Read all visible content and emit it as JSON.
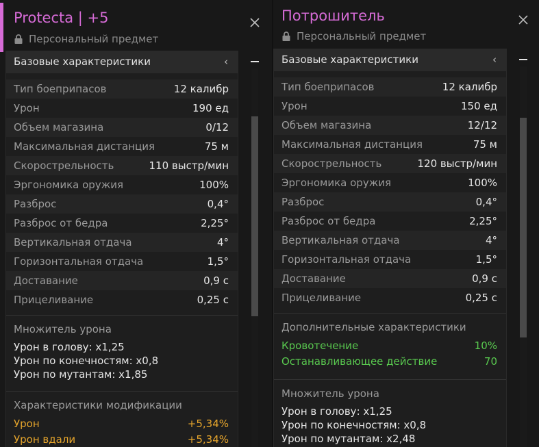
{
  "left": {
    "title": "Protecta | +5",
    "subtitle": "Персональный предмет",
    "section_title": "Базовые характеристики",
    "stats": [
      {
        "k": "Тип боеприпасов",
        "v": "12 калибр"
      },
      {
        "k": "Урон",
        "v": "190 ед"
      },
      {
        "k": "Объем магазина",
        "v": "0/12"
      },
      {
        "k": "Максимальная дистанция",
        "v": "75 м"
      },
      {
        "k": "Скорострельность",
        "v": "110 выстр/мин"
      },
      {
        "k": "Эргономика оружия",
        "v": "100%"
      },
      {
        "k": "Разброс",
        "v": "0,4°"
      },
      {
        "k": "Разброс от бедра",
        "v": "2,25°"
      },
      {
        "k": "Вертикальная отдача",
        "v": "4°"
      },
      {
        "k": "Горизонтальная отдача",
        "v": "1,5°"
      },
      {
        "k": "Доставание",
        "v": "0,9 с"
      },
      {
        "k": "Прицеливание",
        "v": "0,25 с"
      }
    ],
    "damage_multiplier": {
      "title": "Множитель урона",
      "lines": [
        "Урон в голову: x1,25",
        "Урон по конечностям: x0,8",
        "Урон по мутантам: x1,85"
      ]
    },
    "mod_stats": {
      "title": "Характеристики модификации",
      "items": [
        {
          "k": "Урон",
          "v": "+5,34%"
        },
        {
          "k": "Урон вдали",
          "v": "+5,34%"
        }
      ]
    }
  },
  "right": {
    "title": "Потрошитель",
    "subtitle": "Персональный предмет",
    "section_title": "Базовые характеристики",
    "stats": [
      {
        "k": "Тип боеприпасов",
        "v": "12 калибр"
      },
      {
        "k": "Урон",
        "v": "150 ед"
      },
      {
        "k": "Объем магазина",
        "v": "12/12"
      },
      {
        "k": "Максимальная дистанция",
        "v": "75 м"
      },
      {
        "k": "Скорострельность",
        "v": "120 выстр/мин"
      },
      {
        "k": "Эргономика оружия",
        "v": "100%"
      },
      {
        "k": "Разброс",
        "v": "0,4°"
      },
      {
        "k": "Разброс от бедра",
        "v": "2,25°"
      },
      {
        "k": "Вертикальная отдача",
        "v": "4°"
      },
      {
        "k": "Горизонтальная отдача",
        "v": "1,5°"
      },
      {
        "k": "Доставание",
        "v": "0,9 с"
      },
      {
        "k": "Прицеливание",
        "v": "0,25 с"
      }
    ],
    "extra_stats": {
      "title": "Дополнительные характеристики",
      "items": [
        {
          "k": "Кровотечение",
          "v": "10%"
        },
        {
          "k": "Останавливающее действие",
          "v": "70"
        }
      ]
    },
    "damage_multiplier": {
      "title": "Множитель урона",
      "lines": [
        "Урон в голову: x1,25",
        "Урон по конечностям: x0,8",
        "Урон по мутантам: x2,48"
      ]
    }
  },
  "icons": {
    "lock": "lock-icon",
    "close": "close-icon",
    "chevron": "chevron-left-icon",
    "collapse": "minus-icon"
  },
  "colors": {
    "title": "#d66bd6",
    "mod_value": "#e6a52c",
    "extra_value": "#59c94f"
  }
}
